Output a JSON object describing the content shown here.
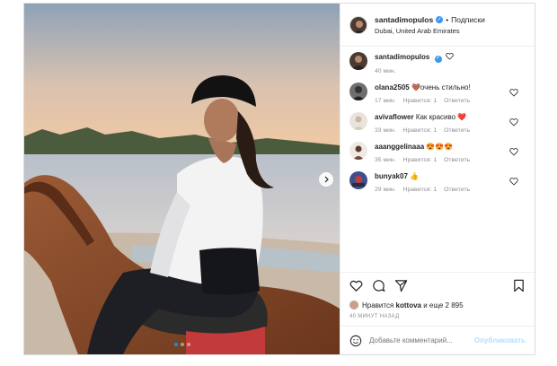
{
  "post": {
    "username": "santadimopulos",
    "follow_label": "Подписки",
    "location": "Dubai, United Arab Emirates"
  },
  "caption": {
    "username": "santadimopulos",
    "time": "40 мин."
  },
  "comments": [
    {
      "username": "olana2505",
      "emoji": "🤎",
      "text": "очень стильно!",
      "time": "17 мин.",
      "likes": "Нравится: 1",
      "reply": "Ответить"
    },
    {
      "username": "avivaflower",
      "text": "Как красиво",
      "emoji": "❤️",
      "time": "33 мин.",
      "likes": "Нравится: 1",
      "reply": "Ответить"
    },
    {
      "username": "aaanggelinaaa",
      "emoji": "😍😍😍",
      "text": "",
      "time": "35 мин.",
      "likes": "Нравится: 1",
      "reply": "Ответить"
    },
    {
      "username": "bunyak07",
      "emoji": "👍",
      "text": "",
      "time": "29 мин.",
      "likes": "Нравится: 1",
      "reply": "Ответить"
    }
  ],
  "likes": {
    "prefix": "Нравится",
    "user": "kottova",
    "suffix": "и еще 2 895"
  },
  "timestamp": "40 МИНУТ НАЗАД",
  "add_comment": {
    "placeholder": "Добавьте комментарий...",
    "publish": "Опубликовать"
  },
  "icons": {
    "like": "heart-icon",
    "comment": "comment-icon",
    "share": "paper-plane-icon",
    "save": "bookmark-icon",
    "emoji": "smiley-icon",
    "next": "chevron-right-icon"
  },
  "colors": {
    "verified": "#3897f0",
    "active_dot": "#0095f6",
    "publish": "#b2dffc"
  },
  "carousel": {
    "count": 3,
    "active": 1
  }
}
